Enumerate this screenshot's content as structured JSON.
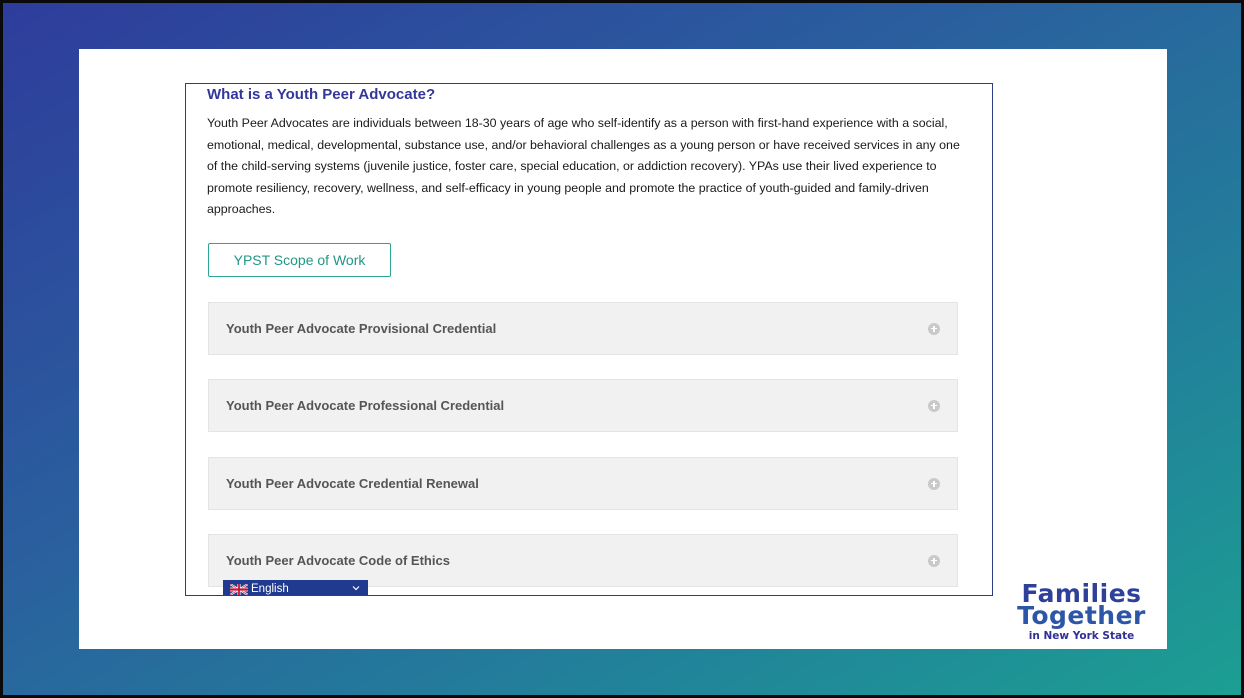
{
  "page": {
    "heading": "What is a Youth Peer Advocate?",
    "description": "Youth Peer Advocates are individuals between 18-30 years of age who self-identify as a person with first-hand experience with a social, emotional, medical, developmental, substance use, and/or behavioral challenges as a young person or have received services in any one of the child-serving systems (juvenile justice, foster care, special education, or addiction recovery). YPAs use their lived experience to promote resiliency, recovery, wellness, and self-efficacy in young people and promote the practice of youth-guided and family-driven approaches.",
    "scope_button": "YPST Scope of Work"
  },
  "accordion": [
    {
      "title": "Youth Peer Advocate Provisional Credential",
      "icon": "plus-circle-icon"
    },
    {
      "title": "Youth Peer Advocate Professional Credential",
      "icon": "plus-circle-icon"
    },
    {
      "title": "Youth Peer Advocate Credential Renewal",
      "icon": "plus-circle-icon"
    },
    {
      "title": "Youth Peer Advocate Code of Ethics",
      "icon": "plus-circle-icon"
    }
  ],
  "language_selector": {
    "selected": "English",
    "flag_icon": "uk-flag-icon",
    "chevron_icon": "chevron-down-icon"
  },
  "logo": {
    "line1": "Families",
    "line2": "Together",
    "line3": "in New York State"
  },
  "colors": {
    "heading": "#34379a",
    "accent_teal": "#219785",
    "accordion_bg": "#f1f1f1",
    "selector_bg": "#1f3a8f",
    "logo_blue": "#2e4099"
  }
}
